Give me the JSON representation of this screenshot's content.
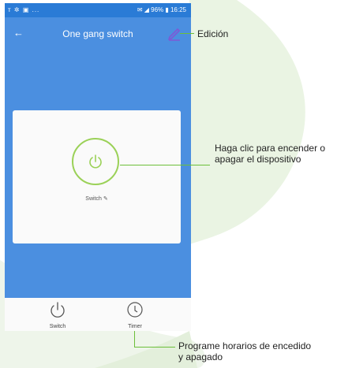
{
  "status": {
    "left": "ᴛ ✲ ▣ ...",
    "right": "✉ ◢ 96% ▮ 16:25"
  },
  "appbar": {
    "back_icon": "←",
    "title": "One gang switch"
  },
  "device": {
    "switch_label": "Switch ✎"
  },
  "tabs": [
    {
      "label": "Switch",
      "icon": "power-icon"
    },
    {
      "label": "Timer",
      "icon": "clock-icon"
    }
  ],
  "callouts": {
    "edit": "Edición",
    "power": "Haga clic para encender o apagar el dispositivo",
    "timer": "Programe horarios de encedido y apagado"
  },
  "colors": {
    "accent_blue": "#4b8fe0",
    "status_blue": "#2a7bd6",
    "power_green": "#9bd158",
    "edit_purple": "#7b5bd6",
    "callout_line": "#6cbf3a"
  }
}
